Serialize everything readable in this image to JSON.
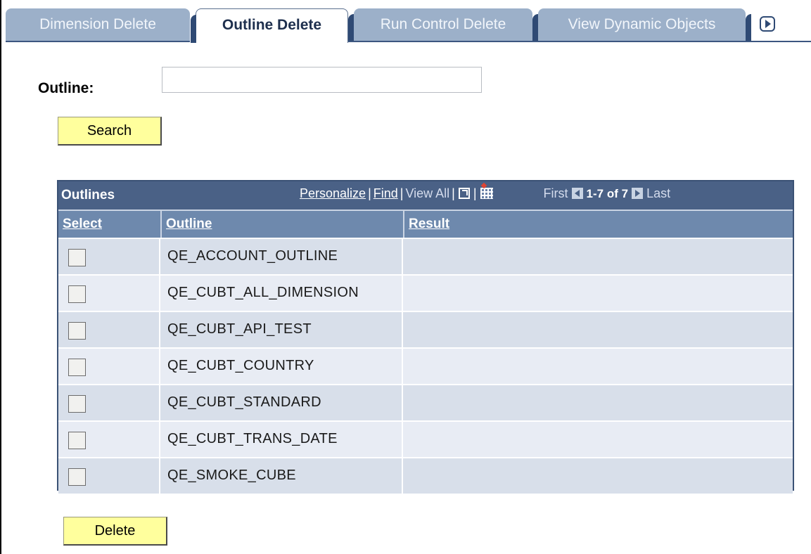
{
  "tabs": [
    {
      "label": "Dimension Delete",
      "active": false
    },
    {
      "label": "Outline Delete",
      "active": true
    },
    {
      "label": "Run Control Delete",
      "active": false
    },
    {
      "label": "View Dynamic Objects",
      "active": false
    }
  ],
  "form": {
    "outline_label": "Outline:",
    "outline_value": "",
    "search_label": "Search",
    "delete_label": "Delete"
  },
  "grid": {
    "title": "Outlines",
    "nav": {
      "personalize": "Personalize",
      "find": "Find",
      "view_all": "View All",
      "first": "First",
      "range": "1-7 of 7",
      "last": "Last"
    },
    "columns": {
      "select": "Select",
      "outline": "Outline",
      "result": "Result"
    },
    "rows": [
      {
        "outline": "QE_ACCOUNT_OUTLINE",
        "result": "",
        "checked": false
      },
      {
        "outline": "QE_CUBT_ALL_DIMENSION",
        "result": "",
        "checked": false
      },
      {
        "outline": "QE_CUBT_API_TEST",
        "result": "",
        "checked": false
      },
      {
        "outline": "QE_CUBT_COUNTRY",
        "result": "",
        "checked": false
      },
      {
        "outline": "QE_CUBT_STANDARD",
        "result": "",
        "checked": false
      },
      {
        "outline": "QE_CUBT_TRANS_DATE",
        "result": "",
        "checked": false
      },
      {
        "outline": "QE_SMOKE_CUBE",
        "result": "",
        "checked": false
      }
    ]
  }
}
